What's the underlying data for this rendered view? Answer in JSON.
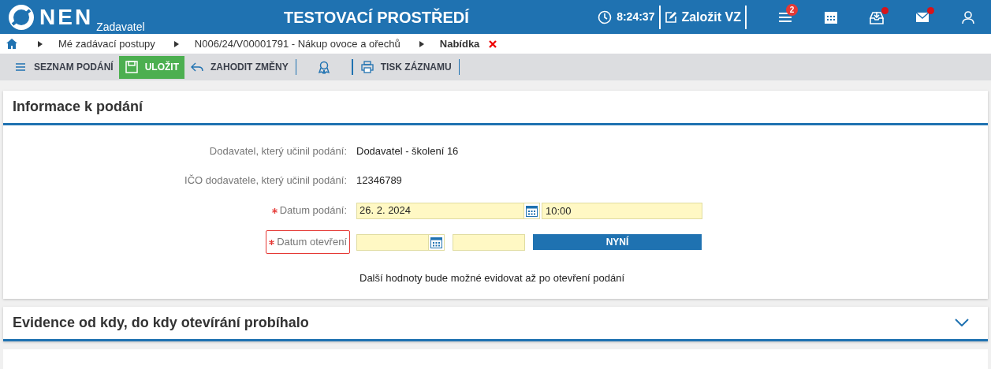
{
  "header": {
    "logo": "NEN",
    "subtitle": "Zadavatel",
    "title": "TESTOVACÍ PROSTŘEDÍ",
    "clock": "8:24:37",
    "create_button": "Založit VZ",
    "icons": [
      {
        "kind": "menu",
        "badge": "2"
      },
      {
        "kind": "calendar"
      },
      {
        "kind": "inbox",
        "dot": true
      },
      {
        "kind": "mail",
        "dot": true
      },
      {
        "kind": "user"
      }
    ]
  },
  "breadcrumbs": [
    {
      "label": "Mé zadávací postupy",
      "current": false
    },
    {
      "label": "N006/24/V00001791 - Nákup ovoce a ořechů",
      "current": false
    },
    {
      "label": "Nabídka",
      "current": true
    }
  ],
  "toolbar": [
    {
      "kind": "list",
      "label": "SEZNAM PODÁNÍ",
      "primary": false
    },
    {
      "kind": "save",
      "label": "ULOŽIT",
      "primary": true
    },
    {
      "kind": "undo",
      "label": "ZAHODIT ZMĚNY",
      "primary": false
    },
    {
      "kind": "award"
    },
    {
      "kind": "print",
      "label": "TISK ZÁZNAMU",
      "primary": false
    }
  ],
  "sections": [
    {
      "title": "Informace k podání",
      "expanded": true,
      "rows": [
        {
          "kind": "text",
          "label": "Dodavatel, který učinil podání:",
          "value": "Dodavatel - školení 16"
        },
        {
          "kind": "text",
          "label": "IČO dodavatele, který učinil podání:",
          "value": "12346789"
        },
        {
          "kind": "datetime",
          "label": "Datum podání:",
          "required": true,
          "invalid": false,
          "date": "26. 2. 2024",
          "time": "10:00"
        },
        {
          "kind": "datetime",
          "label": "Datum otevření",
          "required": true,
          "invalid": true,
          "button": "NYNÍ"
        }
      ],
      "note": "Další hodnoty bude možné evidovat až po otevření podání"
    },
    {
      "title": "Evidence od kdy, do kdy otevírání probíhalo",
      "expanded": false
    }
  ]
}
